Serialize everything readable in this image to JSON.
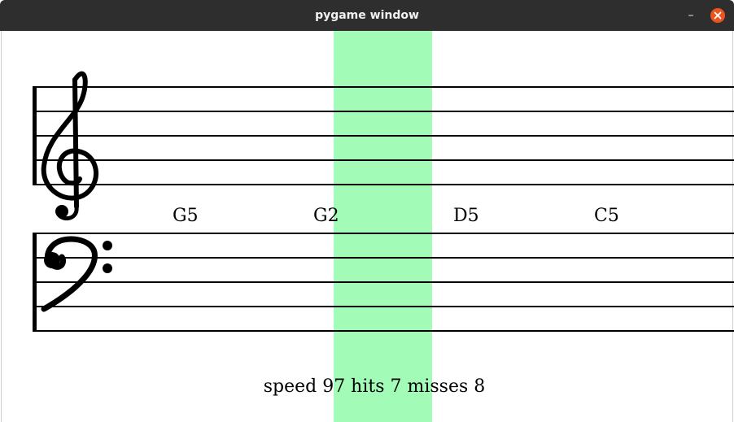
{
  "window": {
    "title": "pygame window",
    "minimize_symbol": "–",
    "close_icon": "close-icon",
    "close_color": "#e95420"
  },
  "score": {
    "treble_clef": "treble-clef-icon",
    "bass_clef": "bass-clef-icon",
    "hit_zone_color": "#a3fbb8",
    "notes": [
      "G5",
      "G2",
      "D5",
      "C5"
    ]
  },
  "status": {
    "text": "speed 97 hits 7 misses 8"
  }
}
